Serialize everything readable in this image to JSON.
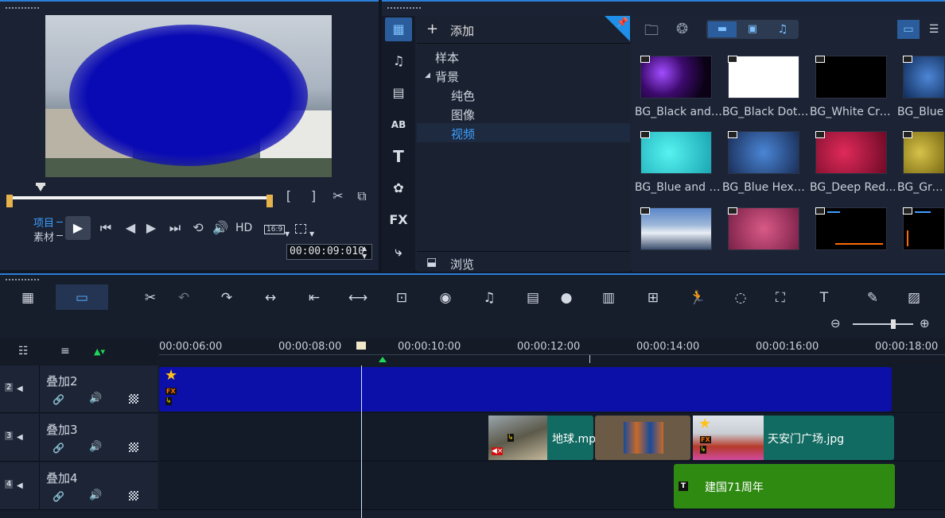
{
  "player": {
    "project_label": "项目",
    "clip_label": "素材",
    "hd_label": "HD",
    "aspect_label": "16:9",
    "timecode": "00:00:09:010",
    "mark_in": "[",
    "mark_out": "]"
  },
  "library": {
    "add_label": "添加",
    "browse_label": "浏览",
    "tree": [
      "样本",
      "背景",
      "纯色",
      "图像",
      "视频"
    ],
    "side_labels": {
      "fx": "FX",
      "text": "T",
      "title": "AB"
    },
    "thumbnails": [
      {
        "label": "BG_Black and ..."
      },
      {
        "label": "BG_Black Dots..."
      },
      {
        "label": "BG_White Cros..."
      },
      {
        "label": "BG_Blue"
      },
      {
        "label": "BG_Blue and G..."
      },
      {
        "label": "BG_Blue Hexa..."
      },
      {
        "label": "BG_Deep Red..."
      },
      {
        "label": "BG_Green"
      }
    ]
  },
  "timeline": {
    "ruler": [
      "00:00:06:00",
      "00:00:08:00",
      "00:00:10:00",
      "00:00:12:00",
      "00:00:14:00",
      "00:00:16:00",
      "00:00:18:00"
    ],
    "tracks": [
      {
        "num": "2",
        "name": "叠加2"
      },
      {
        "num": "3",
        "name": "叠加3"
      },
      {
        "num": "4",
        "name": "叠加4"
      }
    ],
    "clips": {
      "earth": "地球.mp",
      "tiananmen": "天安门广场.jpg",
      "title71": "建国71周年"
    },
    "fx_badge": "FX",
    "text_badge": "T"
  }
}
